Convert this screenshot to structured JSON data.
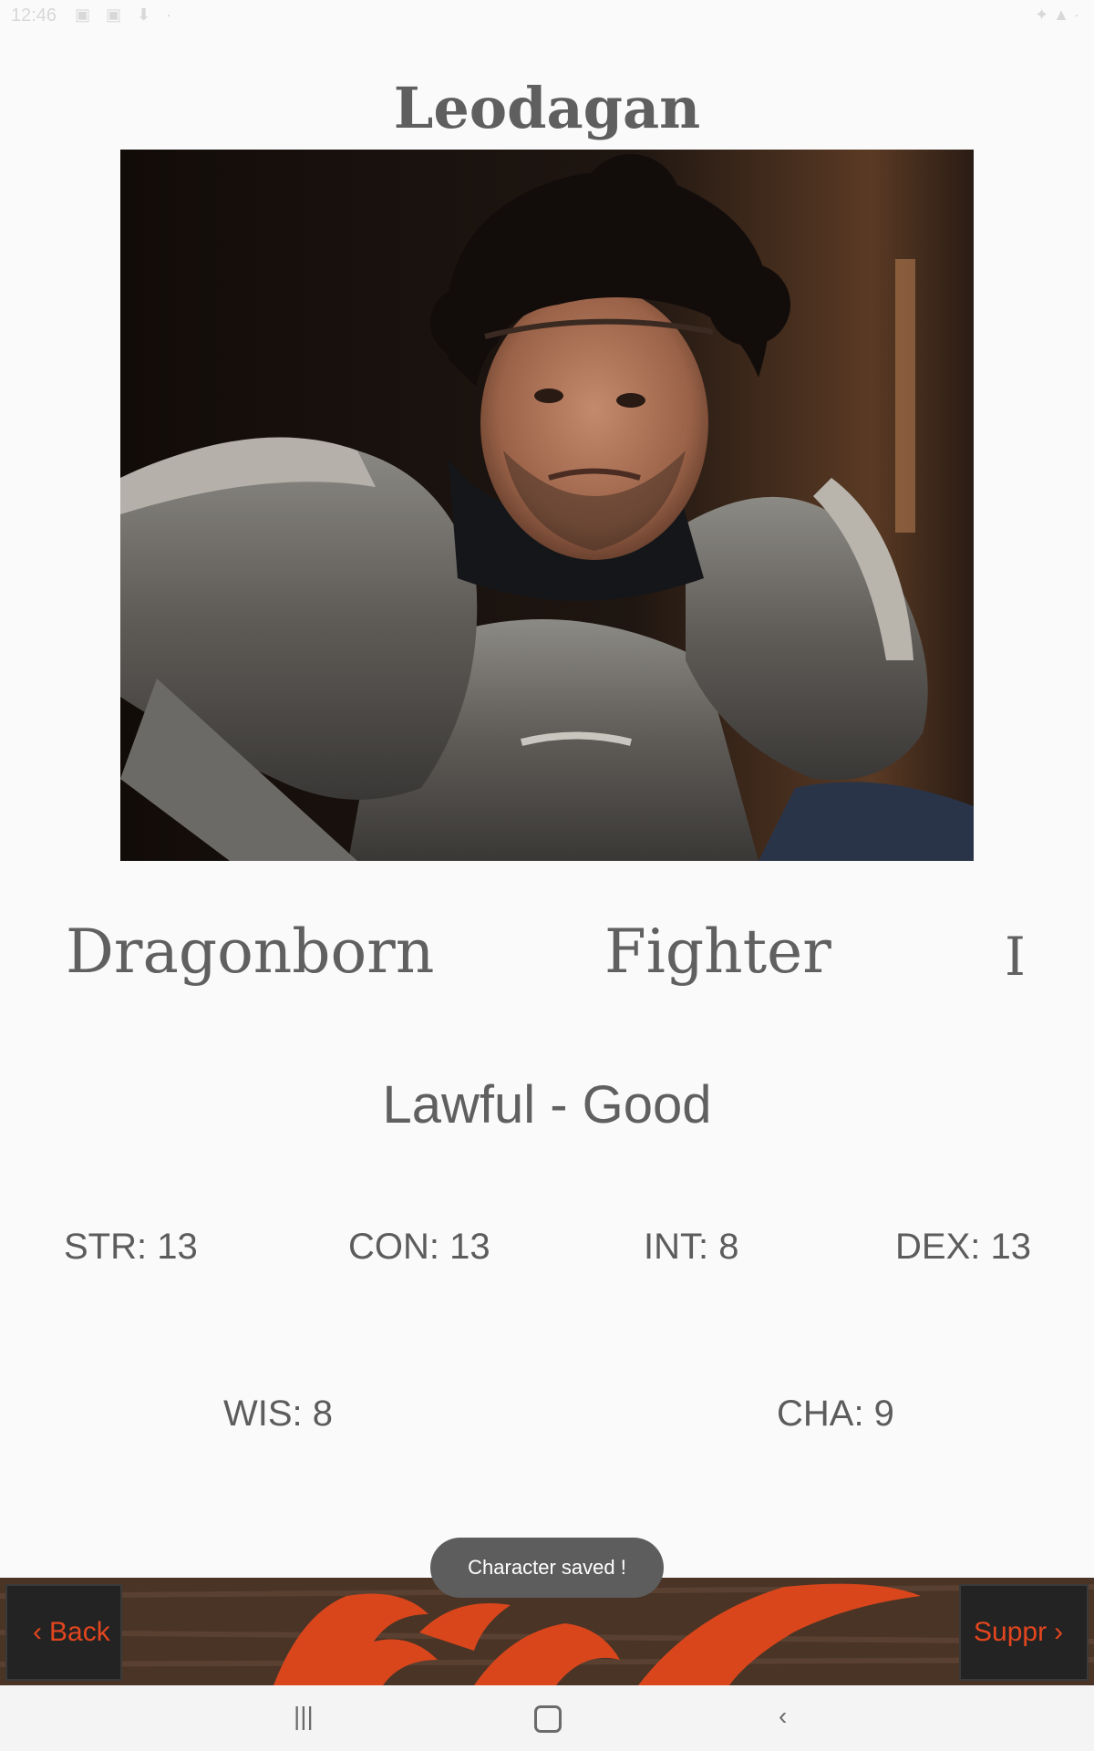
{
  "status_bar": {
    "time": "12:46",
    "icons": "▣ ▣ ⬇ ·",
    "right_icons": "✦ ▲ ·"
  },
  "character": {
    "name": "Leodagan",
    "race": "Dragonborn",
    "class": "Fighter",
    "level": "I",
    "alignment": "Lawful - Good"
  },
  "stats": {
    "str": "STR: 13",
    "con": "CON: 13",
    "int": "INT: 8",
    "dex": "DEX: 13",
    "wis": "WIS: 8",
    "cha": "CHA: 9"
  },
  "toast": "Character saved !",
  "nav": {
    "back_label": "Back",
    "suppr_label": "Suppr",
    "back_icon": "chevron-left-icon",
    "suppr_icon": "chevron-right-icon"
  },
  "system_nav": {
    "recent_icon": "recent-apps-icon",
    "home_icon": "home-icon",
    "back_icon": "back-icon"
  },
  "colors": {
    "accent": "#e3461e",
    "text": "#606060",
    "background": "#fafafa",
    "toast_bg": "#5d5d5d"
  }
}
